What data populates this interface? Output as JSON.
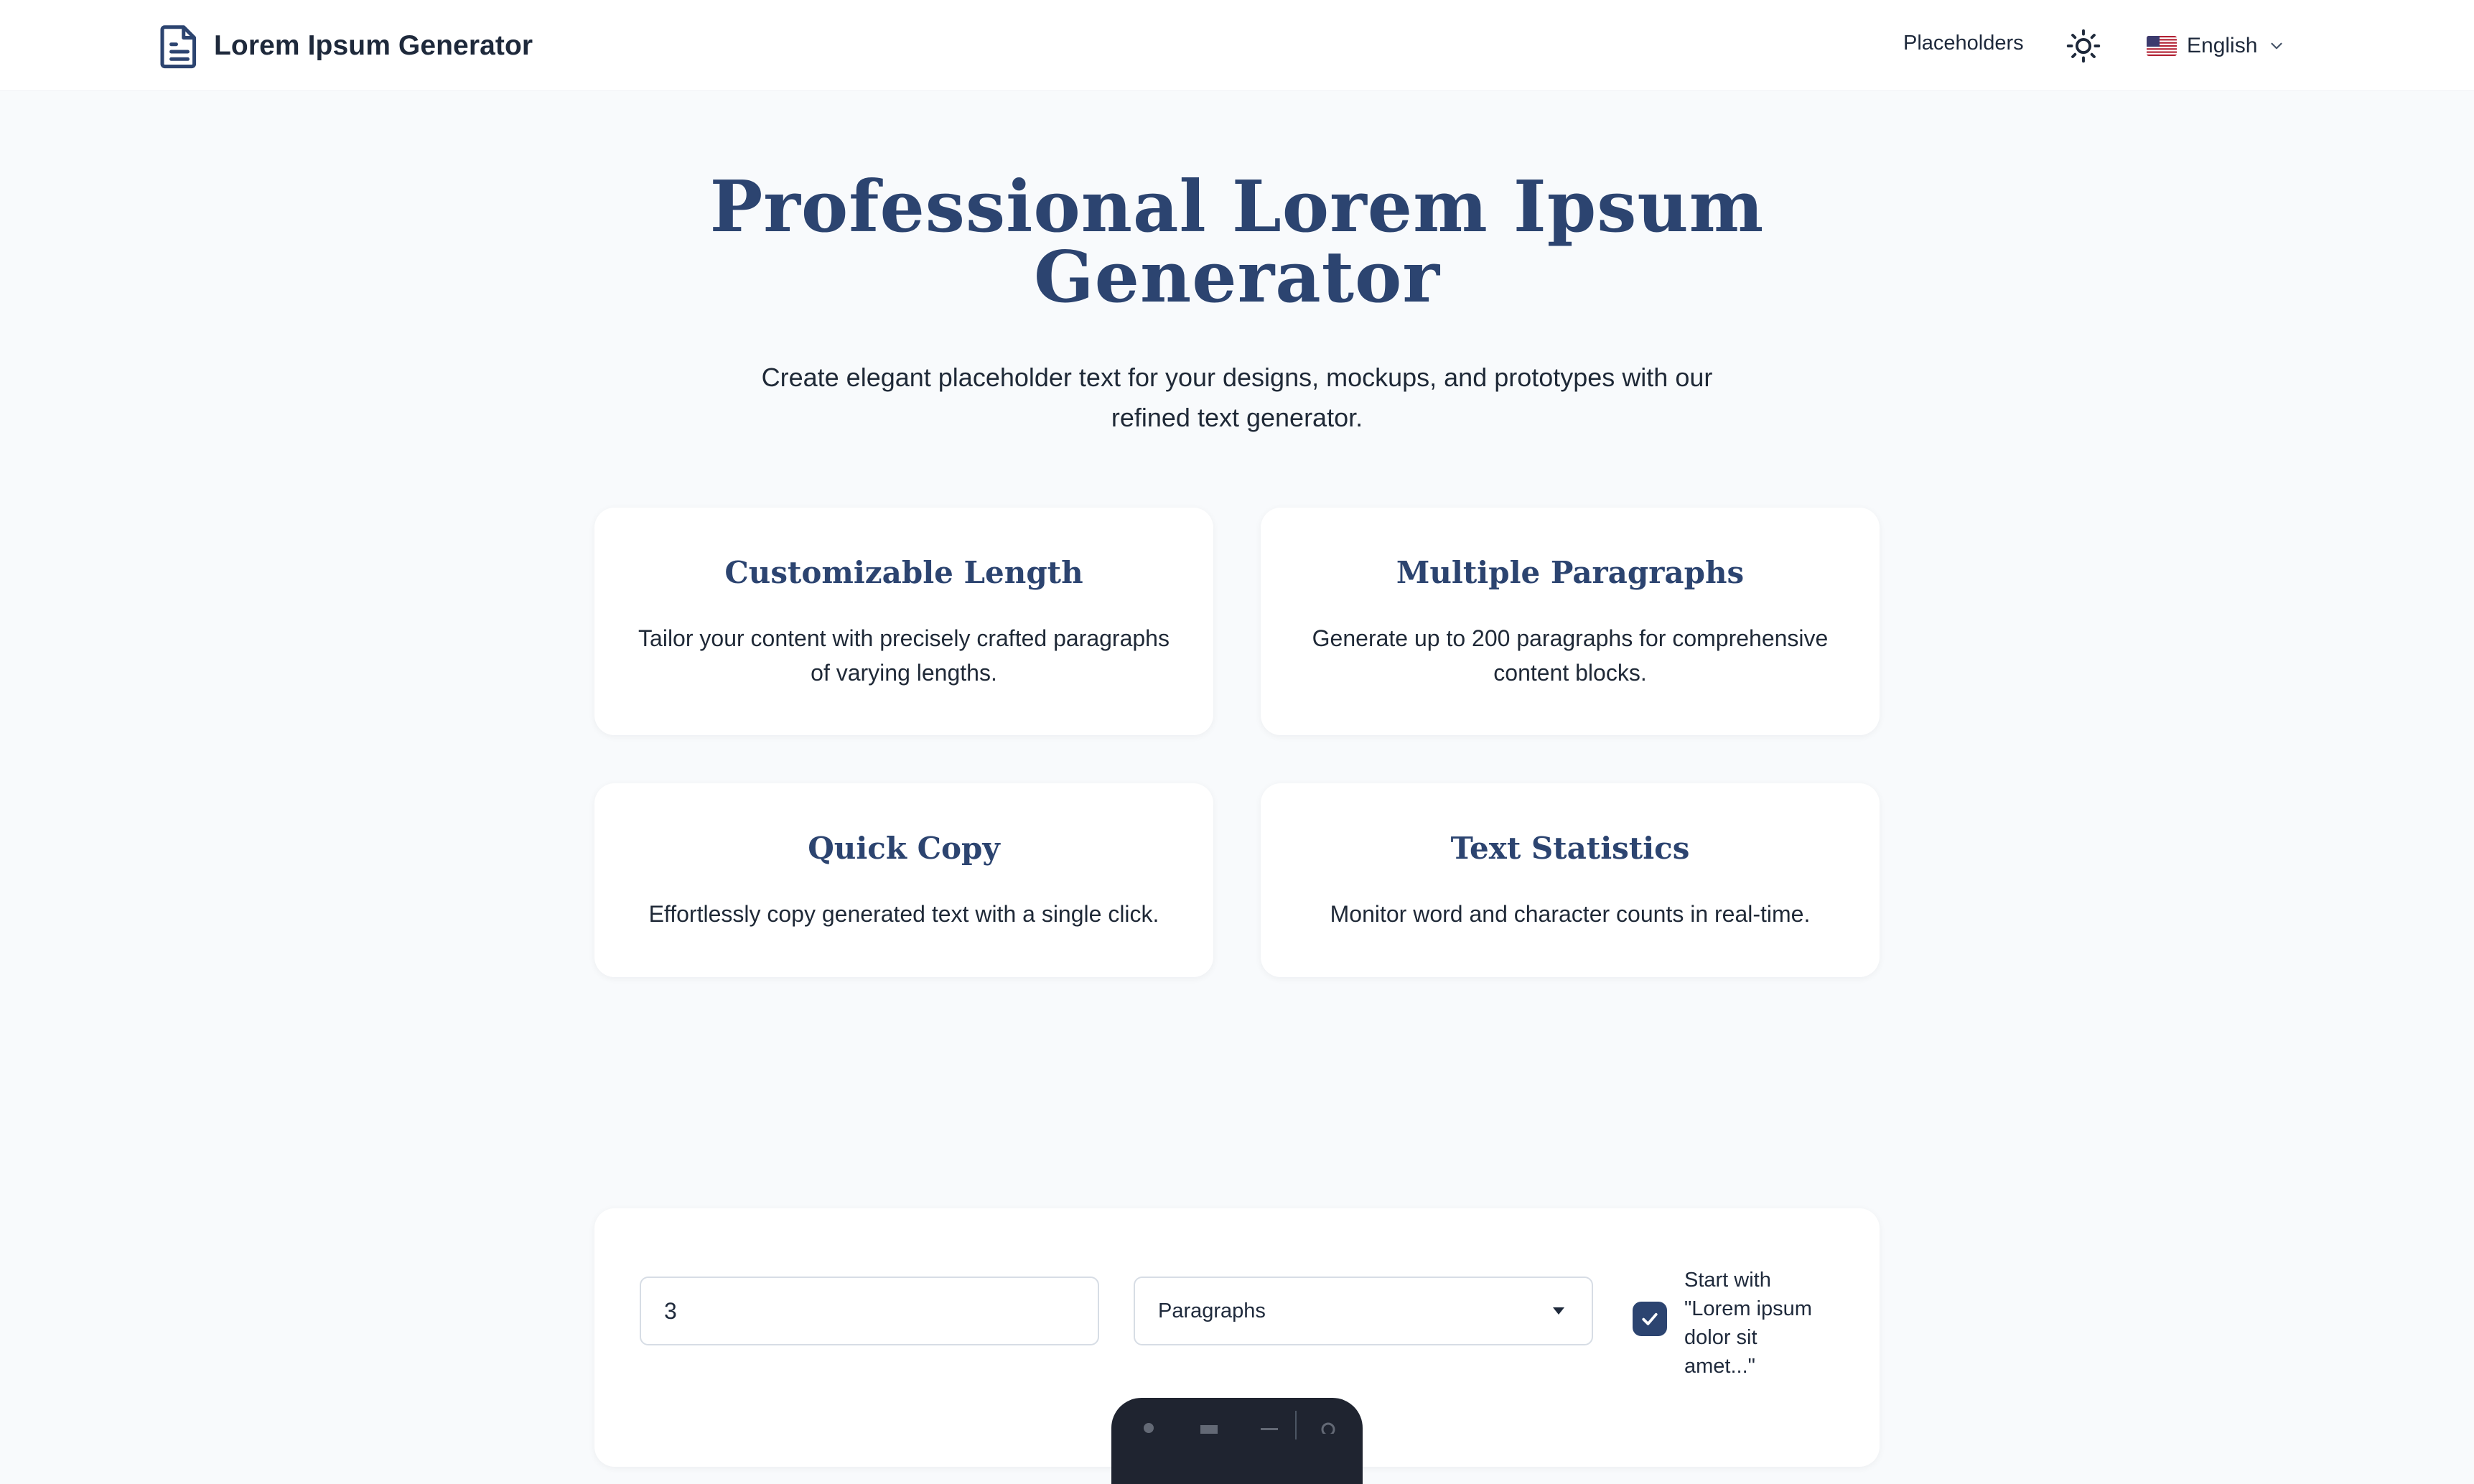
{
  "header": {
    "brand_title": "Lorem Ipsum Generator",
    "nav_placeholders": "Placeholders",
    "language": "English"
  },
  "hero": {
    "title_line1": "Professional Lorem Ipsum",
    "title_line2": "Generator",
    "subtitle": "Create elegant placeholder text for your designs, mockups, and prototypes with our refined text generator."
  },
  "features": [
    {
      "title": "Customizable Length",
      "text": "Tailor your content with precisely crafted paragraphs of varying lengths."
    },
    {
      "title": "Multiple Paragraphs",
      "text": "Generate up to 200 paragraphs for comprehensive content blocks."
    },
    {
      "title": "Quick Copy",
      "text": "Effortlessly copy generated text with a single click."
    },
    {
      "title": "Text Statistics",
      "text": "Monitor word and character counts in real-time."
    }
  ],
  "generator": {
    "count_value": "3",
    "unit_selected": "Paragraphs",
    "start_with_lorem_checked": true,
    "start_with_lorem_label": "Start with \"Lorem ipsum dolor sit amet...\""
  },
  "colors": {
    "accent": "#2c4470",
    "background": "#f8fafc",
    "card": "#ffffff",
    "toolbar": "#1f2430"
  },
  "icons": {
    "brand": "document-icon",
    "theme": "sun-icon",
    "language_flag": "us-flag-icon",
    "language_dropdown": "chevron-down-icon"
  }
}
